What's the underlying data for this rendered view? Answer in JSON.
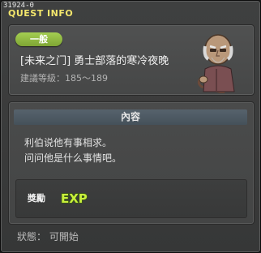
{
  "header": {
    "quest_id": "31924-0",
    "title": "QUEST INFO"
  },
  "quest": {
    "category_badge": "一般",
    "name": "[未来之门] 勇士部落的寒冷夜晚",
    "level_requirement": "建議等級：185～189",
    "npc_icon": "old-man-npc-portrait"
  },
  "content": {
    "section_title": "內容",
    "description_lines": [
      "利伯说他有事相求。",
      "问问他是什么事情吧。"
    ]
  },
  "reward": {
    "label": "獎勵",
    "exp_text": "EXP",
    "exp_icon": "exp-icon"
  },
  "status": {
    "text": "狀態： 可開始"
  },
  "colors": {
    "title": "#f3e66c",
    "badge": "#8db842",
    "exp": "#c9f03c",
    "section_header": "#4d5962"
  }
}
